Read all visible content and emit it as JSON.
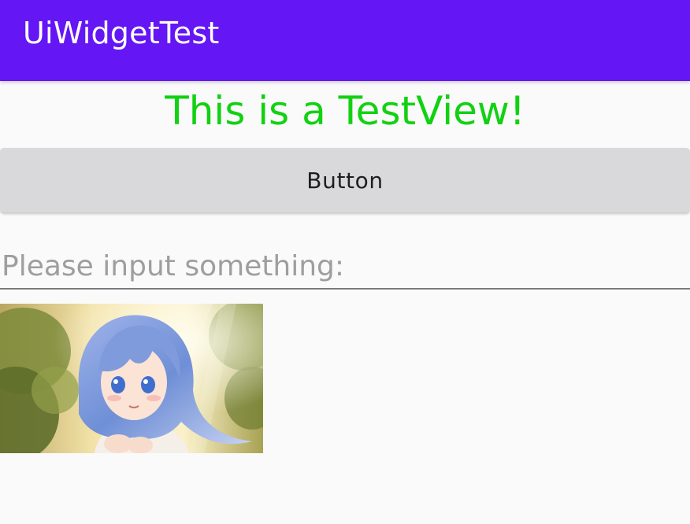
{
  "app_bar": {
    "title": "UiWidgetTest",
    "color": "#6416f5"
  },
  "text_view": {
    "text": "This is a TestView!",
    "color": "#12d112"
  },
  "button": {
    "label": "Button"
  },
  "edit_text": {
    "value": "",
    "placeholder": "Please input something:"
  },
  "image_view": {
    "description": "anime-girl-illustration"
  }
}
